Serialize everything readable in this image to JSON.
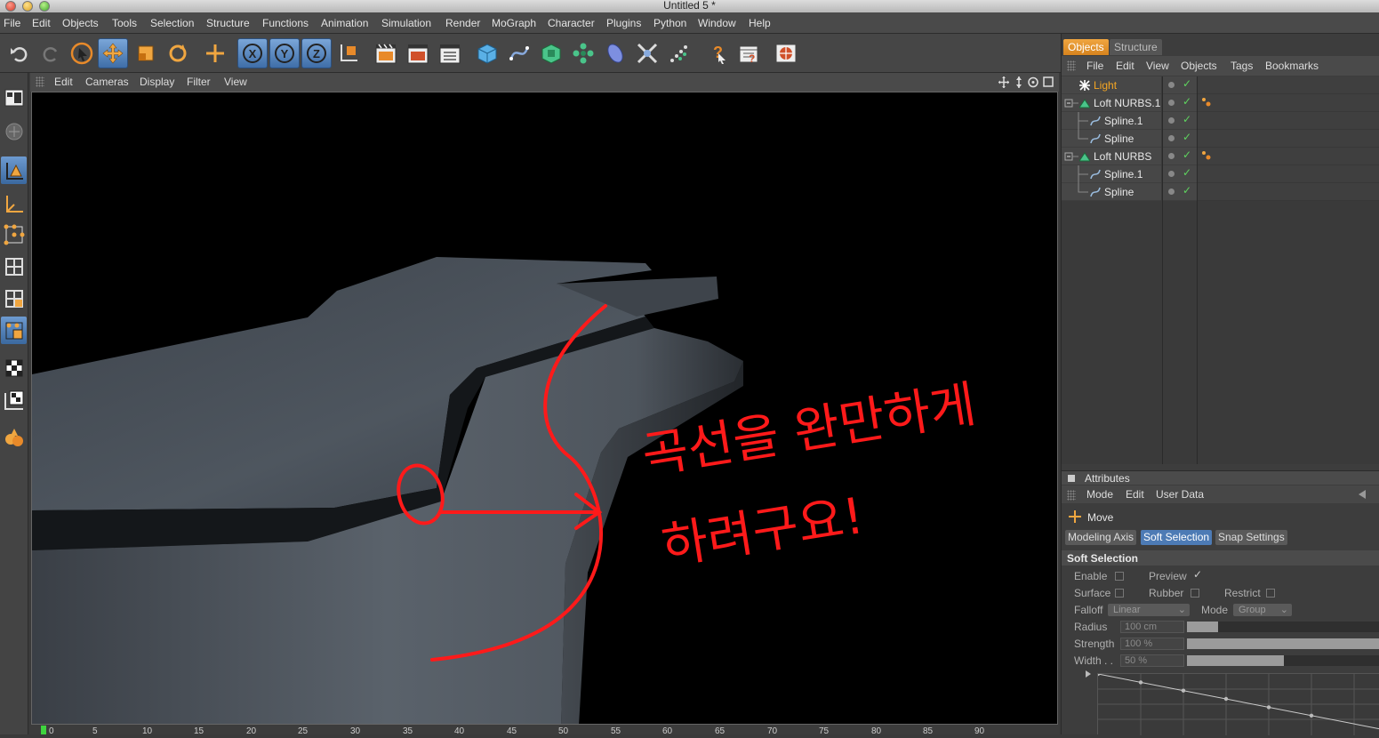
{
  "window": {
    "title": "Untitled 5 *"
  },
  "menubar": [
    "File",
    "Edit",
    "Objects",
    "Tools",
    "Selection",
    "Structure",
    "Functions",
    "Animation",
    "Simulation",
    "Render",
    "MoGraph",
    "Character",
    "Plugins",
    "Python",
    "Window",
    "Help"
  ],
  "toolbar": {
    "axis_x": "X",
    "axis_y": "Y",
    "axis_z": "Z",
    "icons": [
      "undo-icon",
      "redo-icon",
      "live-selection-icon",
      "move-icon",
      "scale-icon",
      "rotate-icon",
      "recent-tool-icon",
      "x-axis-icon",
      "y-axis-icon",
      "z-axis-icon",
      "coordinate-system-icon",
      "render-view-icon",
      "render-picture-viewer-icon",
      "edit-render-settings-icon",
      "cube-icon",
      "spline-pen-icon",
      "nurbs-icon",
      "array-icon",
      "deformer-icon",
      "scene-icon",
      "particle-icon",
      "help-icon",
      "scripts-icon",
      "browser-icon"
    ]
  },
  "viewport": {
    "menu": [
      "Edit",
      "Cameras",
      "Display",
      "Filter",
      "View"
    ],
    "annotation_line1": "곡선을 완만하게",
    "annotation_line2": "하려구요!"
  },
  "timeline": {
    "ticks": [
      "0",
      "5",
      "10",
      "15",
      "20",
      "25",
      "30",
      "35",
      "40",
      "45",
      "50",
      "55",
      "60",
      "65",
      "70",
      "75",
      "80",
      "85",
      "90"
    ]
  },
  "objects_panel": {
    "tabs": [
      "Objects",
      "Structure"
    ],
    "menu": [
      "File",
      "Edit",
      "View",
      "Objects",
      "Tags",
      "Bookmarks"
    ],
    "items": [
      {
        "name": "Light",
        "type": "light",
        "highlighted": true,
        "tag": false
      },
      {
        "name": "Loft NURBS.1",
        "type": "loft",
        "highlighted": false,
        "tag": true
      },
      {
        "name": "Spline.1",
        "type": "spline",
        "highlighted": false,
        "tag": false
      },
      {
        "name": "Spline",
        "type": "spline",
        "highlighted": false,
        "tag": false
      },
      {
        "name": "Loft NURBS",
        "type": "loft",
        "highlighted": false,
        "tag": true
      },
      {
        "name": "Spline.1",
        "type": "spline",
        "highlighted": false,
        "tag": false
      },
      {
        "name": "Spline",
        "type": "spline",
        "highlighted": false,
        "tag": false
      }
    ]
  },
  "attributes": {
    "title": "Attributes",
    "menu": [
      "Mode",
      "Edit",
      "User Data"
    ],
    "tool": "Move",
    "tabs": [
      "Modeling Axis",
      "Soft Selection",
      "Snap Settings"
    ],
    "active_tab": "Soft Selection",
    "section": "Soft Selection",
    "enable_label": "Enable",
    "preview_label": "Preview",
    "preview_checked": "✓",
    "surface_label": "Surface",
    "rubber_label": "Rubber",
    "restrict_label": "Restrict",
    "falloff_label": "Falloff",
    "falloff_value": "Linear",
    "mode_label": "Mode",
    "mode_value": "Group",
    "radius_label": "Radius",
    "radius_value": "100 cm",
    "radius_fill": 0.16,
    "strength_label": "Strength",
    "strength_value": "100 %",
    "strength_fill": 1.0,
    "width_label": "Width . .",
    "width_value": "50 %",
    "width_fill": 0.5
  },
  "colors": {
    "accent": "#f0a640",
    "selection_blue": "#4d7bb5",
    "annotation_red": "#ff1a1a"
  }
}
